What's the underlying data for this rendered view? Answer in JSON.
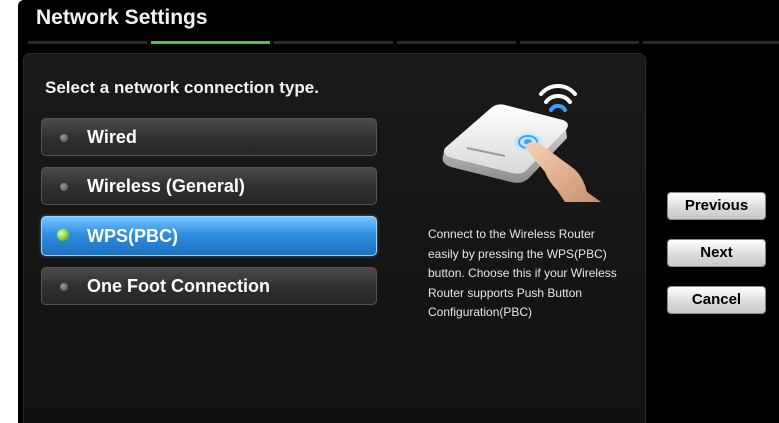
{
  "window": {
    "title": "Network Settings"
  },
  "progress": {
    "total_steps": 6,
    "current_step": 2
  },
  "prompt": "Select a network connection type.",
  "options": [
    {
      "label": "Wired",
      "selected": false
    },
    {
      "label": "Wireless (General)",
      "selected": false
    },
    {
      "label": "WPS(PBC)",
      "selected": true
    },
    {
      "label": "One Foot Connection",
      "selected": false
    }
  ],
  "illustration": {
    "icon": "router-icon",
    "signal_icon": "wifi-signal-icon"
  },
  "description": "Connect to the Wireless Router easily by pressing the WPS(PBC) button. Choose this if your Wireless Router supports Push Button Configuration(PBC)",
  "buttons": {
    "previous": "Previous",
    "next": "Next",
    "cancel": "Cancel"
  },
  "colors": {
    "accent": "#4fc44a",
    "selection": "#2f8fe0"
  }
}
